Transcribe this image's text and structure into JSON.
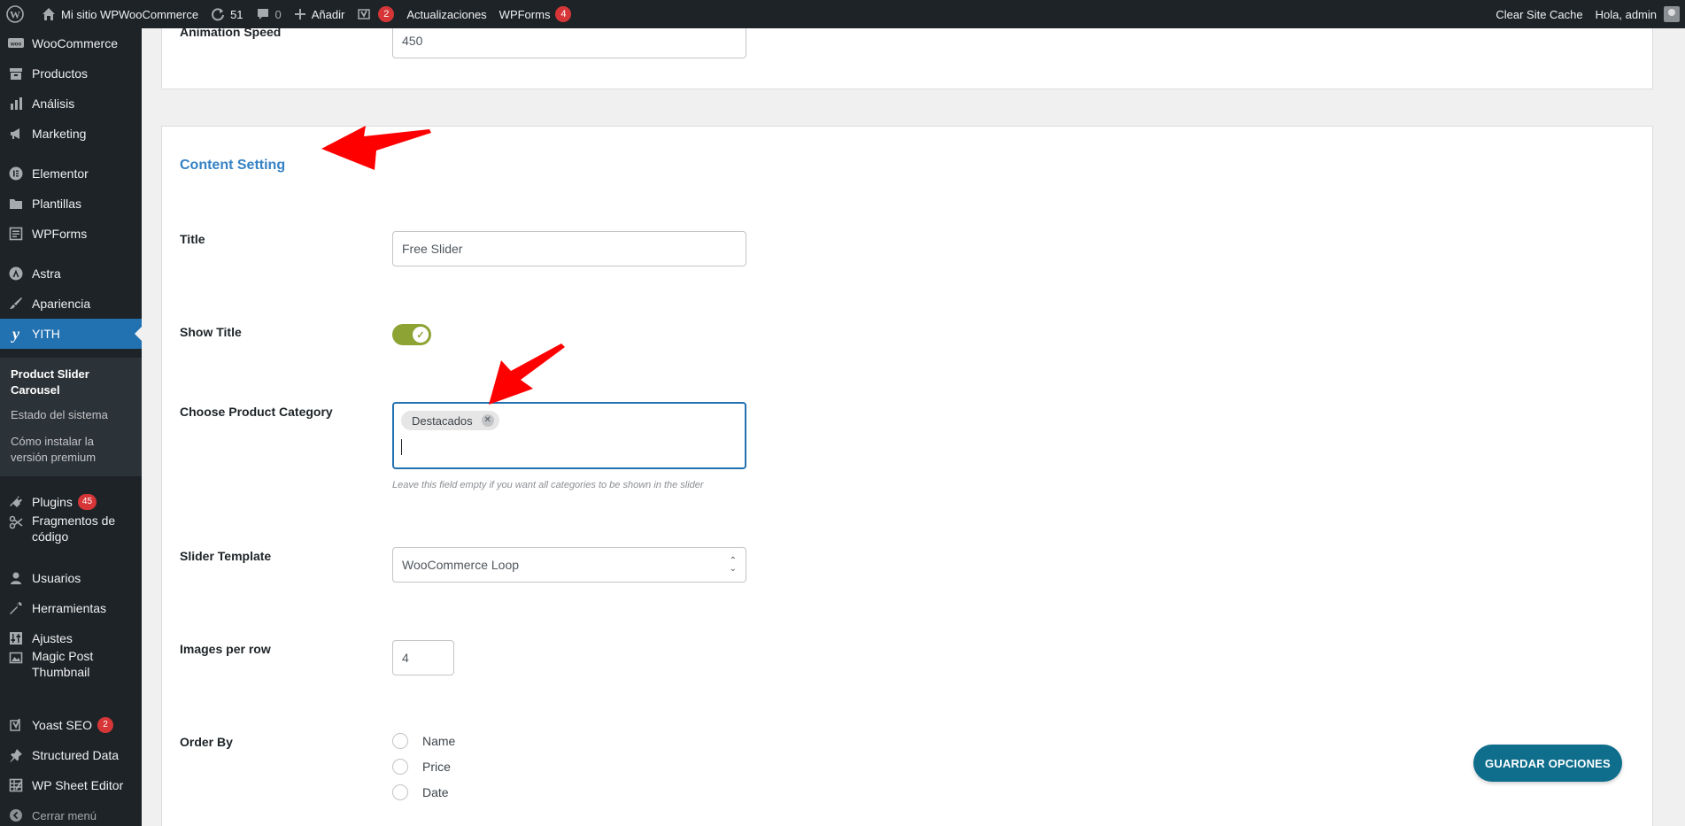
{
  "admin_bar": {
    "site_name": "Mi sitio WPWooCommerce",
    "updates_count": "51",
    "comments_count": "0",
    "add_new": "Añadir",
    "yoast_count": "2",
    "updates_label": "Actualizaciones",
    "wpforms_label": "WPForms",
    "wpforms_count": "4",
    "clear_cache": "Clear Site Cache",
    "greeting": "Hola, admin"
  },
  "sidebar": {
    "items": [
      {
        "label": "WooCommerce",
        "icon": "woo-icon"
      },
      {
        "label": "Productos",
        "icon": "archive-icon"
      },
      {
        "label": "Análisis",
        "icon": "chart-icon"
      },
      {
        "label": "Marketing",
        "icon": "megaphone-icon"
      },
      {
        "label": "Elementor",
        "icon": "elementor-icon"
      },
      {
        "label": "Plantillas",
        "icon": "folder-icon"
      },
      {
        "label": "WPForms",
        "icon": "form-icon"
      },
      {
        "label": "Astra",
        "icon": "astra-icon"
      },
      {
        "label": "Apariencia",
        "icon": "brush-icon"
      },
      {
        "label": "YITH",
        "icon": "yith-icon"
      },
      {
        "label": "Plugins",
        "icon": "plug-icon",
        "count": "45"
      },
      {
        "label": "Fragmentos de código",
        "icon": "scissors-icon"
      },
      {
        "label": "Usuarios",
        "icon": "user-icon"
      },
      {
        "label": "Herramientas",
        "icon": "wrench-icon"
      },
      {
        "label": "Ajustes",
        "icon": "sliders-icon"
      },
      {
        "label": "Magic Post Thumbnail",
        "icon": "image-icon"
      },
      {
        "label": "Yoast SEO",
        "icon": "yoast-icon",
        "count": "2"
      },
      {
        "label": "Structured Data",
        "icon": "pin-icon"
      },
      {
        "label": "WP Sheet Editor",
        "icon": "table-icon"
      }
    ],
    "submenu": [
      {
        "label": "Product Slider Carousel"
      },
      {
        "label": "Estado del sistema"
      },
      {
        "label": "Cómo instalar la versión premium"
      }
    ],
    "collapse": "Cerrar menú"
  },
  "top_card": {
    "label": "Animation Speed",
    "value": "450"
  },
  "content": {
    "section_title": "Content Setting",
    "title_label": "Title",
    "title_value": "Free Slider",
    "show_title_label": "Show Title",
    "show_title_on": true,
    "category_label": "Choose Product Category",
    "category_tag": "Destacados",
    "category_help": "Leave this field empty if you want all categories to be shown in the slider",
    "template_label": "Slider Template",
    "template_value": "WooCommerce Loop",
    "images_label": "Images per row",
    "images_value": "4",
    "order_label": "Order By",
    "order_options": [
      "Name",
      "Price",
      "Date"
    ]
  },
  "save_button": "GUARDAR OPCIONES",
  "colors": {
    "accent": "#2271b1",
    "section_title": "#3582c4",
    "toggle_on": "#8da333",
    "save_button": "#0e6e8c",
    "annotation_arrow": "#ff0000"
  }
}
